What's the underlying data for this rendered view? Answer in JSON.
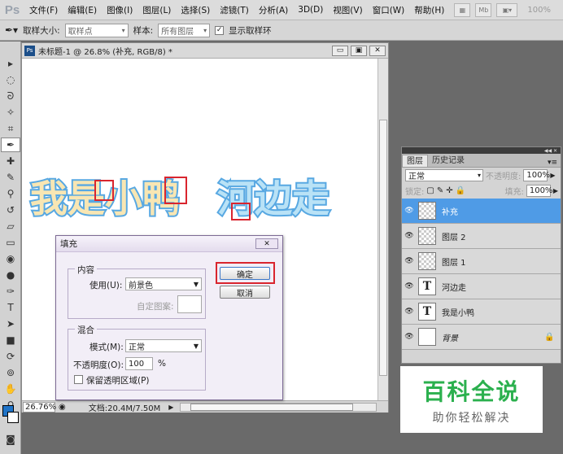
{
  "app": {
    "logo": "Ps"
  },
  "menu": [
    "文件(F)",
    "编辑(E)",
    "图像(I)",
    "图层(L)",
    "选择(S)",
    "滤镜(T)",
    "分析(A)",
    "3D(D)",
    "视图(V)",
    "窗口(W)",
    "帮助(H)"
  ],
  "menubar_buttons": {
    "mb": "Mb",
    "zoom": "100%"
  },
  "options": {
    "sample_size_label": "取样大小:",
    "sample_size_value": "取样点",
    "sample_label": "样本:",
    "sample_value": "所有图层",
    "show_ring_label": "显示取样环",
    "show_ring_checked": "✓"
  },
  "document": {
    "title": "未标题-1 @ 26.8% (补充, RGB/8) *",
    "ps_badge": "Ps",
    "zoom": "26.76%",
    "doc_info": "文档:20.4M/7.50M",
    "art_text_1": "我是小鸭",
    "art_text_2": "河边走",
    "art_fill_color": "#f8e6b3",
    "art_stroke_color": "#58a8e2",
    "art_text_2_fill": "#b9e2f6"
  },
  "fill_dialog": {
    "title": "填充",
    "close": "✕",
    "contents_group": "内容",
    "use_label": "使用(U):",
    "use_value": "前景色",
    "pattern_label": "自定图案:",
    "blend_group": "混合",
    "mode_label": "模式(M):",
    "mode_value": "正常",
    "opacity_label": "不透明度(O):",
    "opacity_value": "100",
    "opacity_unit": "%",
    "preserve_label": "保留透明区域(P)",
    "ok": "确定",
    "cancel": "取消"
  },
  "layers_panel": {
    "tab_layers": "图层",
    "tab_history": "历史记录",
    "blend_mode": "正常",
    "opacity_label": "不透明度:",
    "opacity_value": "100%",
    "lock_label": "锁定:",
    "fill_label": "填充:",
    "fill_value": "100%",
    "layers": [
      {
        "name": "补充",
        "type": "raster",
        "selected": true
      },
      {
        "name": "图层 2",
        "type": "raster",
        "selected": false
      },
      {
        "name": "图层 1",
        "type": "raster",
        "selected": false
      },
      {
        "name": "河边走",
        "type": "text",
        "selected": false
      },
      {
        "name": "我是小鸭",
        "type": "text",
        "selected": false
      },
      {
        "name": "背景",
        "type": "background",
        "selected": false
      }
    ],
    "text_thumb": "T"
  },
  "watermark": {
    "title": "百科全说",
    "subtitle": "助你轻松解决"
  },
  "colors": {
    "foreground": "#1f73c7",
    "selection": "#4f9be6",
    "highlight": "#d9252e"
  }
}
